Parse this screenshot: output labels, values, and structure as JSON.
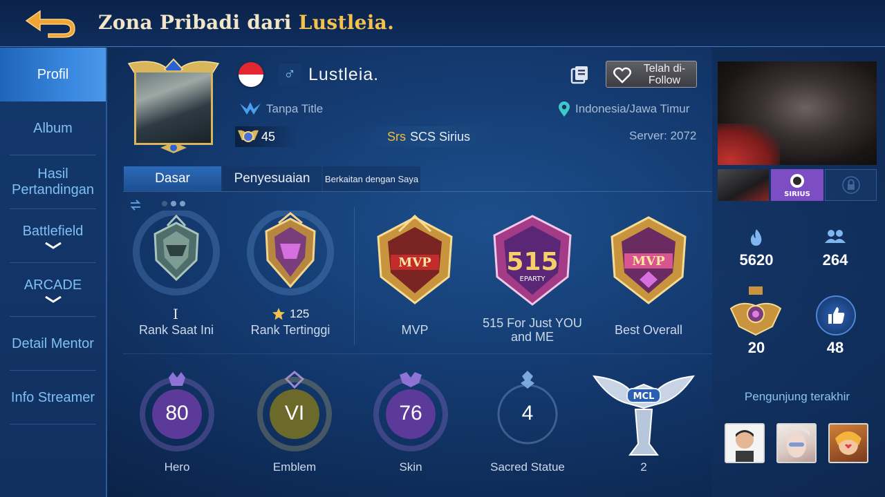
{
  "header": {
    "title_prefix": "Zona Pribadi dari ",
    "title_name": "Lustleia."
  },
  "sidebar": {
    "items": [
      {
        "label": "Profil",
        "active": true
      },
      {
        "label": "Album"
      },
      {
        "label": "Hasil Pertandingan"
      },
      {
        "label": "Battlefield"
      },
      {
        "label": "ARCADE"
      },
      {
        "label": "Detail Mentor"
      },
      {
        "label": "Info Streamer"
      }
    ]
  },
  "profile": {
    "username": "Lustleia.",
    "gender_symbol": "♂",
    "title": "Tanpa Title",
    "location": "Indonesia/Jawa Timur",
    "level": "45",
    "squad_tag": "Srs",
    "squad_name": "SCS Sirius",
    "server": "Server: 2072",
    "follow_label": "Telah di-Follow"
  },
  "tabs": [
    {
      "label": "Dasar",
      "active": true
    },
    {
      "label": "Penyesuaian"
    },
    {
      "label": "Berkaitan dengan Saya"
    }
  ],
  "badges": [
    {
      "label": "Rank Saat Ini",
      "mark": "I"
    },
    {
      "label": "Rank Tertinggi",
      "stars": "125"
    },
    {
      "label": "MVP",
      "emblem_text": "MVP"
    },
    {
      "label": "515 For Just YOU and ME",
      "emblem_text": "515",
      "emblem_sub": "EPARTY"
    },
    {
      "label": "Best Overall",
      "emblem_text": "MVP"
    }
  ],
  "stats": [
    {
      "label": "Hero",
      "value": "80"
    },
    {
      "label": "Emblem",
      "value": "VI"
    },
    {
      "label": "Skin",
      "value": "76"
    },
    {
      "label": "Sacred Statue",
      "value": "4"
    },
    {
      "label": "2",
      "emblem_text": "MCL"
    }
  ],
  "right": {
    "squad_thumb_text": "SIRIUS",
    "popularity": "5620",
    "followers": "264",
    "achievement": "20",
    "likes": "48",
    "visitors_label": "Pengunjung terakhir"
  },
  "colors": {
    "accent_gold": "#f4c24c",
    "sidebar_text": "#7fc0f3",
    "active_tab": "#2b6ab8"
  }
}
